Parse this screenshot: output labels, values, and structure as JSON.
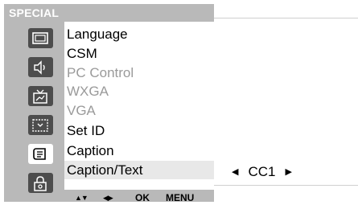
{
  "menu": {
    "title": "SPECIAL",
    "items": [
      {
        "label": "Language",
        "enabled": true,
        "selected": false
      },
      {
        "label": "CSM",
        "enabled": true,
        "selected": false
      },
      {
        "label": "PC Control",
        "enabled": false,
        "selected": false
      },
      {
        "label": "WXGA",
        "enabled": false,
        "selected": false
      },
      {
        "label": "VGA",
        "enabled": false,
        "selected": false
      },
      {
        "label": "Set ID",
        "enabled": true,
        "selected": false
      },
      {
        "label": "Caption",
        "enabled": true,
        "selected": false
      },
      {
        "label": "Caption/Text",
        "enabled": true,
        "selected": true
      }
    ],
    "icons": [
      "picture-icon",
      "sound-icon",
      "time-icon",
      "screen-icon",
      "special-icon",
      "lock-icon"
    ],
    "active_icon": "special-icon"
  },
  "navbar": {
    "updown_label": "▲▼",
    "leftright_label": "◀▶",
    "ok_label": "OK",
    "menu_label": "MENU"
  },
  "submenu": {
    "value": "CC1",
    "left_arrow": "◀",
    "right_arrow": "▶"
  },
  "colors": {
    "panel": "#b9b9b9",
    "icon_fill": "#4d4d4d",
    "disabled_text": "#9a9a9a",
    "selected_row": "#e8e8e8"
  }
}
